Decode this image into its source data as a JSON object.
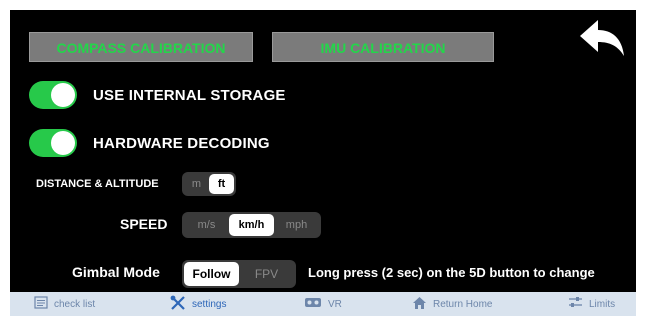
{
  "calibration": {
    "compass_label": "COMPASS CALIBRATION",
    "imu_label": "IMU CALIBRATION",
    "text_color": "#23d64a"
  },
  "toggles": {
    "storage_label": "USE INTERNAL STORAGE",
    "storage_on": true,
    "decoding_label": "HARDWARE DECODING",
    "decoding_on": true,
    "on_color": "#27c94a"
  },
  "distance": {
    "label": "DISTANCE & ALTITUDE",
    "options": [
      "m",
      "ft"
    ],
    "selected": "ft"
  },
  "speed": {
    "label": "SPEED",
    "options": [
      "m/s",
      "km/h",
      "mph"
    ],
    "selected": "km/h"
  },
  "gimbal": {
    "label": "Gimbal Mode",
    "options": [
      "Follow",
      "FPV"
    ],
    "selected": "Follow",
    "hint": "Long press (2 sec) on the 5D button to change"
  },
  "tabbar": {
    "items": [
      {
        "label": "check list",
        "icon": "checklist-icon"
      },
      {
        "label": "settings",
        "icon": "wrench-screwdriver-icon",
        "active": true
      },
      {
        "label": "VR",
        "icon": "vr-goggles-icon"
      },
      {
        "label": "Return Home",
        "icon": "home-icon"
      },
      {
        "label": "Limits",
        "icon": "sliders-icon"
      }
    ]
  }
}
